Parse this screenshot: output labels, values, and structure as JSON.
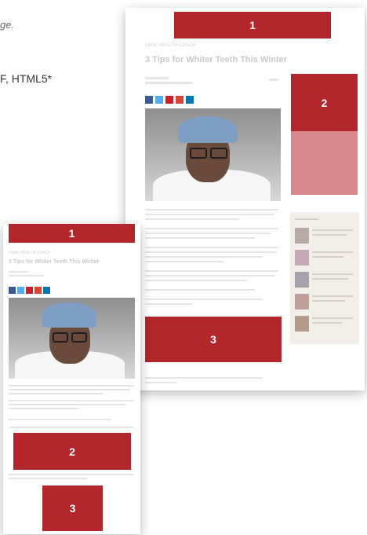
{
  "header_caption": "ge.",
  "formats_line": "F, HTML5*",
  "desktop": {
    "ad_top_label": "1",
    "ad_right_label": "2",
    "ad_bottom_label": "3",
    "article_title": "3 Tips for Whiter Teeth This Winter",
    "kicker": "ORAL HEALTH COACH"
  },
  "mobile": {
    "ad_top_label": "1",
    "ad_mid_label": "2",
    "ad_bottom_label": "3",
    "article_title": "3 Tips for Whiter Teeth This Winter",
    "kicker": "ORAL HEALTH COACH"
  },
  "colors": {
    "ad_red": "#b3262b",
    "ad_red_light": "#da8a8c",
    "social": [
      "#3b5998",
      "#55acee",
      "#cb2027",
      "#d34836",
      "#0077b5"
    ]
  }
}
